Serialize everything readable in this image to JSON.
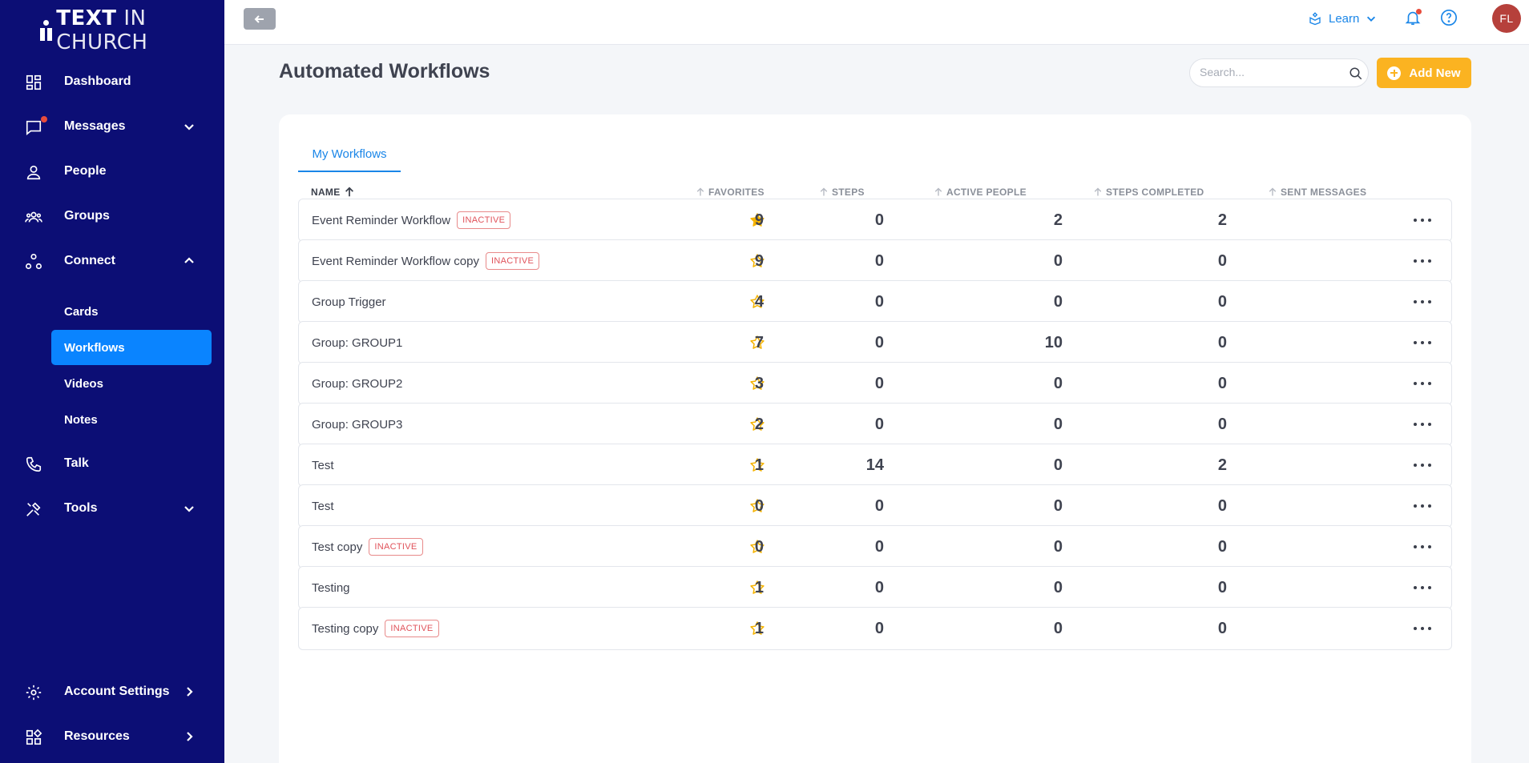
{
  "brand": {
    "logo_bold": "TEXT",
    "logo_light": "IN CHURCH"
  },
  "sidebar": {
    "items": [
      {
        "label": "Dashboard"
      },
      {
        "label": "Messages"
      },
      {
        "label": "People"
      },
      {
        "label": "Groups"
      },
      {
        "label": "Connect"
      },
      {
        "label": "Talk"
      },
      {
        "label": "Tools"
      },
      {
        "label": "Account Settings"
      },
      {
        "label": "Resources"
      }
    ],
    "connect_sub": [
      {
        "label": "Cards"
      },
      {
        "label": "Workflows"
      },
      {
        "label": "Videos"
      },
      {
        "label": "Notes"
      }
    ]
  },
  "topbar": {
    "learn_label": "Learn",
    "avatar_initials": "FL"
  },
  "page": {
    "title": "Automated Workflows",
    "search_placeholder": "Search...",
    "add_label": "Add New",
    "tab_label": "My Workflows"
  },
  "table": {
    "headers": {
      "name": "NAME",
      "favorites": "FAVORITES",
      "steps": "STEPS",
      "active_people": "ACTIVE PEOPLE",
      "steps_completed": "STEPS COMPLETED",
      "sent_messages": "SENT MESSAGES"
    },
    "inactive_label": "INACTIVE",
    "rows": [
      {
        "name": "Event Reminder Workflow",
        "inactive": "INACTIVE",
        "favorite": true,
        "steps": "9",
        "active_people": "0",
        "steps_completed": "2",
        "sent_messages": "2"
      },
      {
        "name": "Event Reminder Workflow copy",
        "inactive": "INACTIVE",
        "favorite": false,
        "steps": "9",
        "active_people": "0",
        "steps_completed": "0",
        "sent_messages": "0"
      },
      {
        "name": "Group Trigger",
        "favorite": false,
        "steps": "4",
        "active_people": "0",
        "steps_completed": "0",
        "sent_messages": "0"
      },
      {
        "name": "Group: GROUP1",
        "favorite": false,
        "steps": "7",
        "active_people": "0",
        "steps_completed": "10",
        "sent_messages": "0"
      },
      {
        "name": "Group: GROUP2",
        "favorite": false,
        "steps": "3",
        "active_people": "0",
        "steps_completed": "0",
        "sent_messages": "0"
      },
      {
        "name": "Group: GROUP3",
        "favorite": false,
        "steps": "2",
        "active_people": "0",
        "steps_completed": "0",
        "sent_messages": "0"
      },
      {
        "name": "Test",
        "favorite": false,
        "steps": "1",
        "active_people": "14",
        "steps_completed": "0",
        "sent_messages": "2"
      },
      {
        "name": "Test",
        "favorite": false,
        "steps": "0",
        "active_people": "0",
        "steps_completed": "0",
        "sent_messages": "0"
      },
      {
        "name": "Test copy",
        "inactive": "INACTIVE",
        "favorite": false,
        "steps": "0",
        "active_people": "0",
        "steps_completed": "0",
        "sent_messages": "0"
      },
      {
        "name": "Testing",
        "favorite": false,
        "steps": "1",
        "active_people": "0",
        "steps_completed": "0",
        "sent_messages": "0"
      },
      {
        "name": "Testing copy",
        "inactive": "INACTIVE",
        "favorite": false,
        "steps": "1",
        "active_people": "0",
        "steps_completed": "0",
        "sent_messages": "0"
      }
    ]
  },
  "colors": {
    "sidebar_bg": "#0c0e75",
    "accent": "#1a86e8",
    "add_button": "#fbb321",
    "star": "#f5b301",
    "inactive": "#e0525a",
    "avatar": "#b6403b"
  },
  "icons": [
    "dashboard-icon",
    "message-icon",
    "person-icon",
    "groups-icon",
    "connect-icon",
    "phone-icon",
    "tools-icon",
    "gear-icon",
    "resources-icon",
    "back-arrow-icon",
    "learn-icon",
    "bell-icon",
    "help-icon",
    "search-icon",
    "plus-icon",
    "star-icon",
    "more-icon"
  ]
}
